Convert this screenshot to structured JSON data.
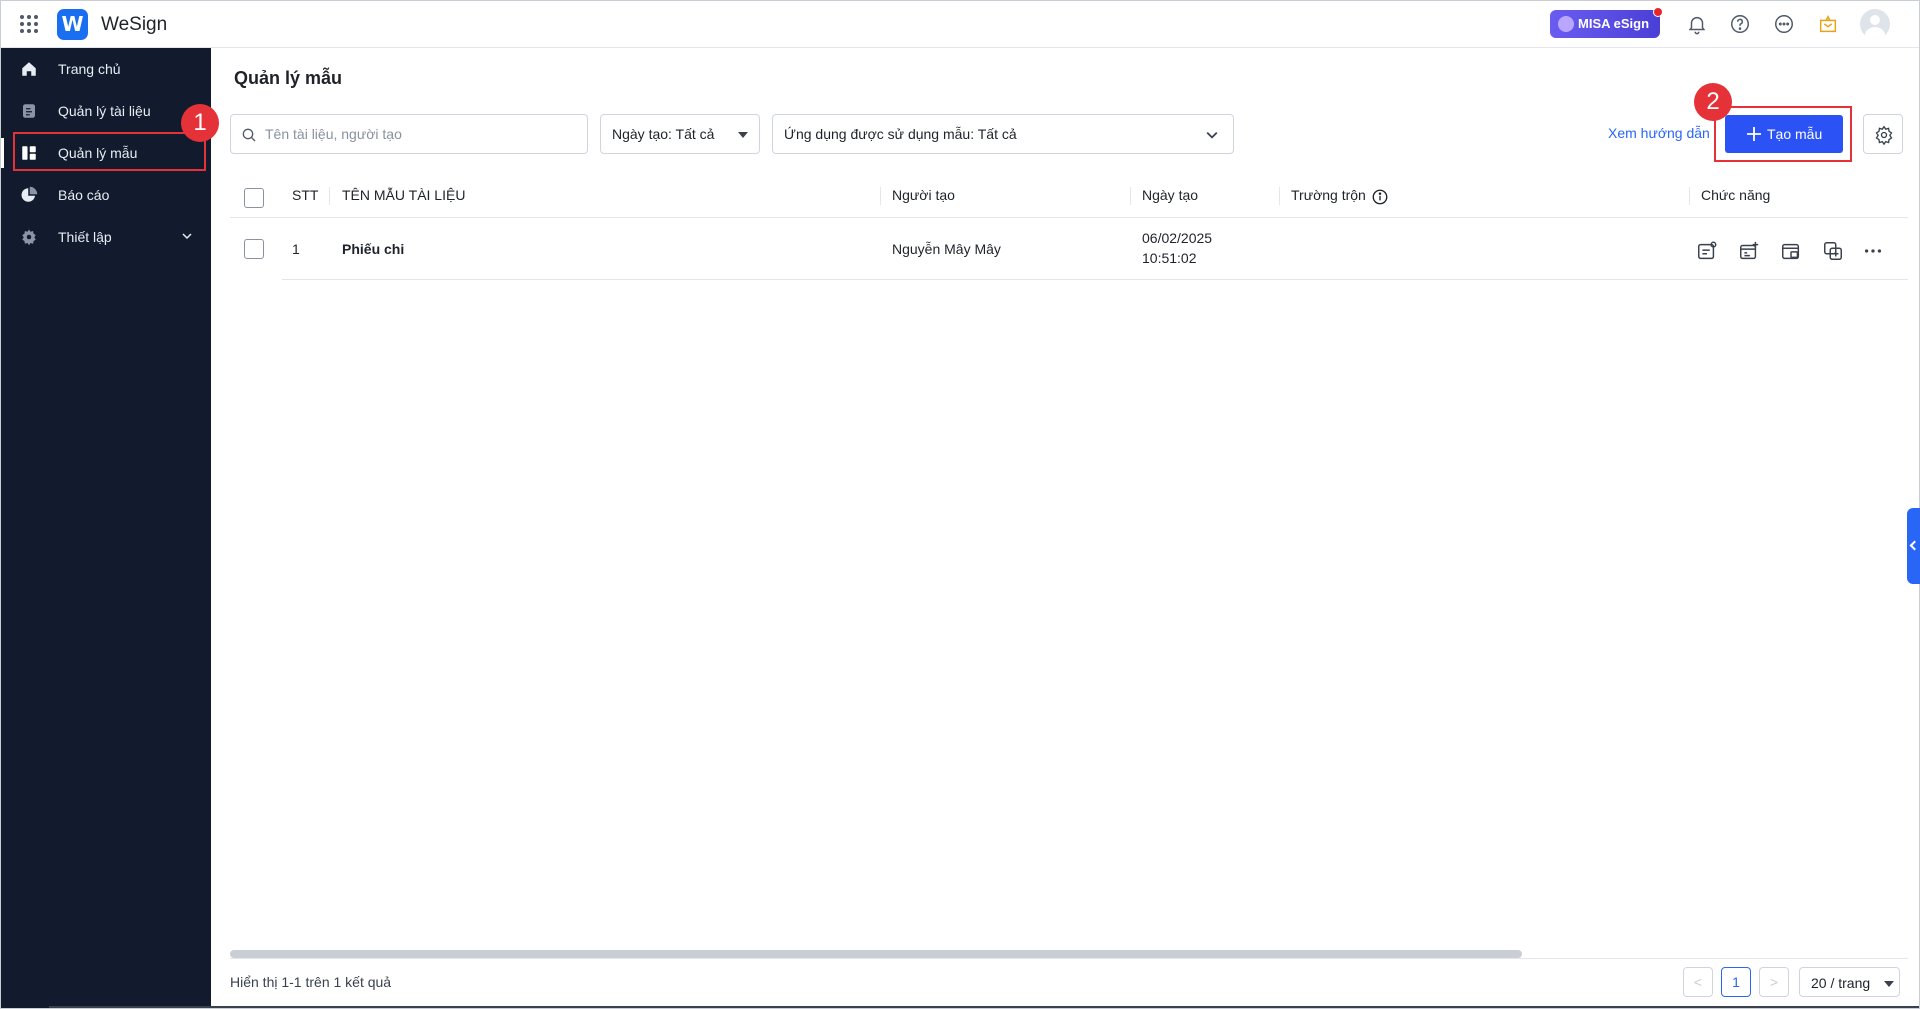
{
  "topbar": {
    "brand": "WeSign",
    "misa_badge": "MISA eSign",
    "icons": [
      "apps-grid-icon",
      "bell-icon",
      "help-icon",
      "chat-icon",
      "gift-icon",
      "avatar"
    ]
  },
  "sidebar": {
    "items": [
      {
        "label": "Trang chủ",
        "icon": "home-icon"
      },
      {
        "label": "Quản lý tài liệu",
        "icon": "document-icon"
      },
      {
        "label": "Quản lý mẫu",
        "icon": "template-icon",
        "active": true
      },
      {
        "label": "Báo cáo",
        "icon": "pie-chart-icon"
      },
      {
        "label": "Thiết lập",
        "icon": "gear-icon",
        "expandable": true
      }
    ]
  },
  "callouts": {
    "one": "1",
    "two": "2"
  },
  "main": {
    "title": "Quản lý mẫu",
    "search_placeholder": "Tên tài liệu, người tạo",
    "date_filter": "Ngày tạo: Tất cả",
    "app_filter": "Ứng dụng được sử dụng mẫu: Tất cả",
    "guide_link": "Xem hướng dẫn",
    "create_button": "Tạo mẫu"
  },
  "table": {
    "columns": [
      "STT",
      "TÊN MẪU TÀI LIỆU",
      "Người tạo",
      "Ngày tạo",
      "Trường trộn",
      "Chức năng"
    ],
    "rows": [
      {
        "stt": "1",
        "name": "Phiếu chi",
        "creator": "Nguyễn Mây Mây",
        "date": "06/02/2025",
        "time": "10:51:02"
      }
    ]
  },
  "footer": {
    "summary": "Hiển thị 1-1 trên 1 kết quả",
    "current_page": "1",
    "prev": "<",
    "next": ">",
    "per_page": "20 / trang"
  },
  "colors": {
    "sidebar_bg": "#111b2d",
    "primary": "#2a52f5",
    "link": "#2a66f6",
    "highlight": "#e53238"
  }
}
